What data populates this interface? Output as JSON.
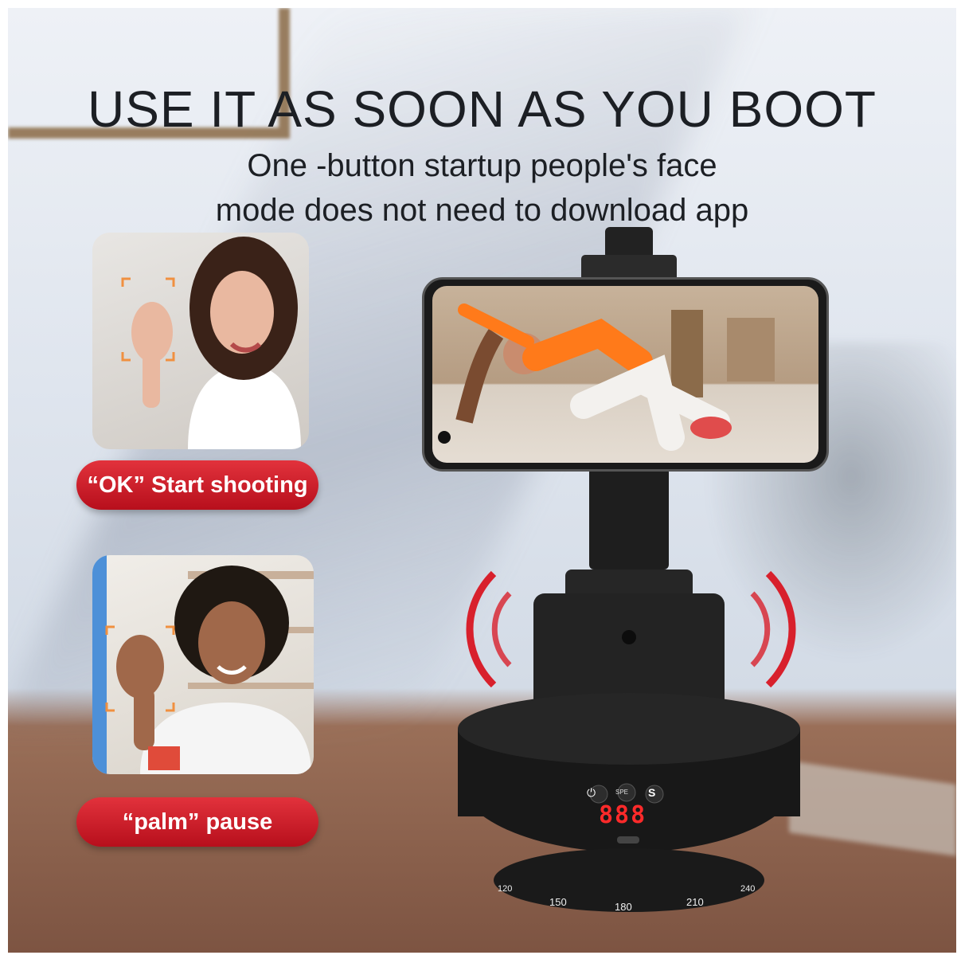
{
  "headline": "USE IT AS SOON AS YOU BOOT",
  "subhead_line1": "One -button startup people's face",
  "subhead_line2": "mode does not need to download app",
  "gesture_ok_label": "“OK” Start shooting",
  "gesture_palm_label": "“palm” pause",
  "device": {
    "led_readout": "888",
    "button_labels": [
      "SPE",
      "S"
    ],
    "dial_numbers": [
      "120",
      "150",
      "180",
      "210",
      "240"
    ]
  },
  "colors": {
    "pill_red": "#d11a28",
    "wave_red": "#d8202c"
  }
}
